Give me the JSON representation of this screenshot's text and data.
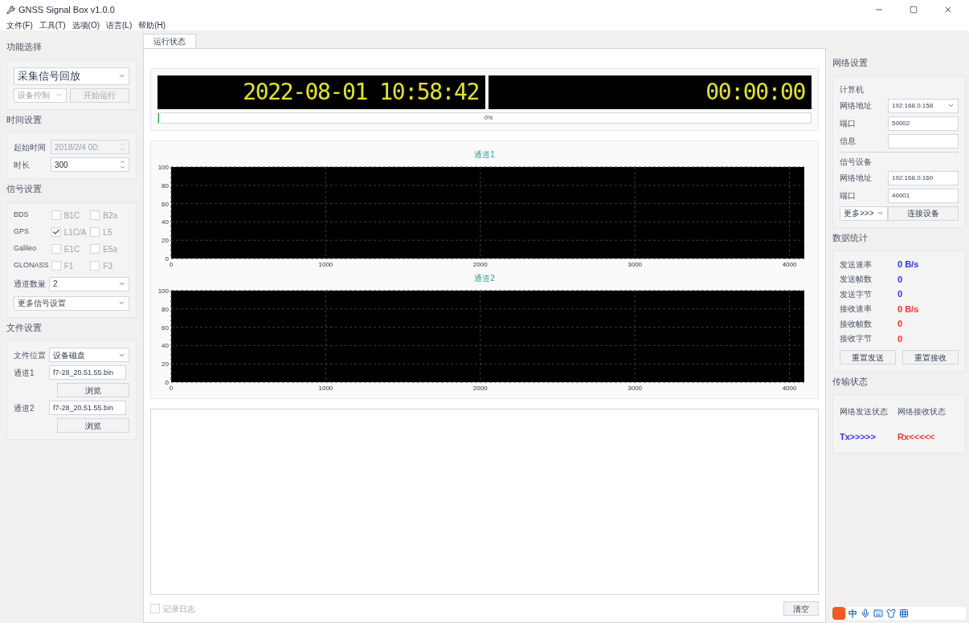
{
  "window": {
    "title": "GNSS Signal Box v1.0.0"
  },
  "menu": [
    "文件(F)",
    "工具(T)",
    "选项(O)",
    "语言(L)",
    "帮助(H)"
  ],
  "left": {
    "function": {
      "title": "功能选择",
      "mode": "采集信号回放",
      "device_control": {
        "label": "设备控制",
        "disabled": true
      },
      "start": {
        "label": "开始运行",
        "disabled": true
      }
    },
    "time": {
      "title": "时间设置",
      "fields": [
        {
          "label": "起始时间",
          "value": "2018/2/4 00:",
          "disabled": true
        },
        {
          "label": "时长",
          "value": "300",
          "disabled": false
        }
      ]
    },
    "signal": {
      "title": "信号设置",
      "systems": [
        {
          "name": "BDS",
          "bands": [
            {
              "label": "B1C",
              "checked": false
            },
            {
              "label": "B2a",
              "checked": false
            }
          ]
        },
        {
          "name": "GPS",
          "bands": [
            {
              "label": "L1C/A",
              "checked": true
            },
            {
              "label": "L5",
              "checked": false
            }
          ]
        },
        {
          "name": "Galileo",
          "bands": [
            {
              "label": "E1C",
              "checked": false
            },
            {
              "label": "E5a",
              "checked": false
            }
          ]
        },
        {
          "name": "GLONASS",
          "bands": [
            {
              "label": "F1",
              "checked": false
            },
            {
              "label": "F3",
              "checked": false
            }
          ]
        }
      ],
      "channel_count": {
        "label": "通道数量",
        "value": "2"
      },
      "more": "更多信号设置"
    },
    "file": {
      "title": "文件设置",
      "location": {
        "label": "文件位置",
        "value": "设备磁盘"
      },
      "channels": [
        {
          "label": "通道1",
          "value": "f7-28_20.51.55.bin",
          "browse": "浏览"
        },
        {
          "label": "通道2",
          "value": "f7-28_20.51.55.bin",
          "browse": "浏览"
        }
      ]
    }
  },
  "tabs": [
    {
      "label": "运行状态",
      "selected": true
    }
  ],
  "clock": {
    "datetime": "2022-08-01 10:58:42",
    "elapsed": "00:00:00",
    "progress": {
      "level": 0,
      "reading": "0%"
    }
  },
  "charts": [
    {
      "chart_data": {
        "type": "line",
        "grid": true,
        "title": "通道1",
        "xlim": [
          0,
          4096
        ],
        "ylim": [
          0,
          100
        ],
        "xticks": [
          0,
          1000,
          2000,
          3000,
          4000
        ],
        "yticks": [
          0,
          20,
          40,
          60,
          80,
          100
        ]
      }
    },
    {
      "chart_data": {
        "type": "line",
        "grid": true,
        "title": "通道2",
        "xlim": [
          0,
          4096
        ],
        "ylim": [
          0,
          100
        ],
        "xticks": [
          0,
          1000,
          2000,
          3000,
          4000
        ],
        "yticks": [
          0,
          20,
          40,
          60,
          80,
          100
        ]
      }
    }
  ],
  "log": {
    "record": {
      "label": "记录日志",
      "checked": false
    },
    "clear": "清空"
  },
  "right": {
    "network": {
      "title": "网络设置",
      "computer": {
        "title": "计算机",
        "address": {
          "label": "网络地址",
          "value": "192.168.0.158"
        },
        "port": {
          "label": "端口",
          "value": "50002"
        },
        "info": {
          "label": "信息"
        }
      },
      "device": {
        "title": "信号设备",
        "address": {
          "label": "网络地址",
          "value": "192.168.0.160"
        },
        "port": {
          "label": "端口",
          "value": "40001"
        }
      },
      "more": "更多>>>",
      "connect": "连接设备"
    },
    "stats": {
      "title": "数据统计",
      "rows": [
        {
          "label": "发送速率",
          "value": "0 B/s",
          "color": "#3333ff"
        },
        {
          "label": "发送帧数",
          "value": "0",
          "color": "#3333ff"
        },
        {
          "label": "发送字节",
          "value": "0",
          "color": "#3333ff"
        },
        {
          "label": "接收速率",
          "value": "0 B/s",
          "color": "#ff3333"
        },
        {
          "label": "接收帧数",
          "value": "0",
          "color": "#ff3333"
        },
        {
          "label": "接收字节",
          "value": "0",
          "color": "#ff3333"
        }
      ],
      "buttons": [
        "重置发送",
        "重置接收"
      ]
    },
    "transfer": {
      "title": "传输状态",
      "items": [
        {
          "label": "网络发送状态",
          "value": "Tx>>>>>",
          "color": "#3333ff"
        },
        {
          "label": "网络接收状态",
          "value": "Rx<<<<<",
          "color": "#ff3333"
        }
      ]
    }
  },
  "ime": {
    "label": "中"
  }
}
